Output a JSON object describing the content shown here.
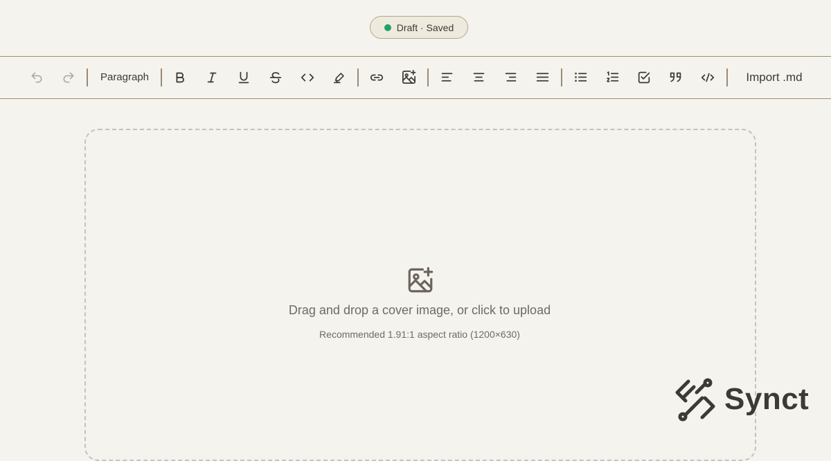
{
  "status": {
    "label": "Draft · Saved",
    "dot_color": "#1fa365"
  },
  "toolbar": {
    "undo_icon": "undo-icon",
    "redo_icon": "redo-icon",
    "block_type": "Paragraph",
    "format_icons": [
      "bold-icon",
      "italic-icon",
      "underline-icon",
      "strikethrough-icon",
      "inline-code-icon",
      "highlight-icon"
    ],
    "insert_icons": [
      "link-icon",
      "insert-image-icon"
    ],
    "align_icons": [
      "align-left-icon",
      "align-center-icon",
      "align-right-icon",
      "align-justify-icon"
    ],
    "list_icons": [
      "bullet-list-icon",
      "ordered-list-icon",
      "task-list-icon",
      "blockquote-icon",
      "code-block-icon"
    ],
    "import_label": "Import .md"
  },
  "dropzone": {
    "icon": "image-plus-icon",
    "title": "Drag and drop a cover image, or click to upload",
    "subtitle": "Recommended 1.91:1 aspect ratio (1200×630)"
  },
  "brand": {
    "name": "Synct",
    "icon": "synct-logo-icon"
  },
  "colors": {
    "background": "#f5f3ee",
    "border": "#a08d73",
    "text": "#3d3a36",
    "muted": "#6f6a63"
  }
}
